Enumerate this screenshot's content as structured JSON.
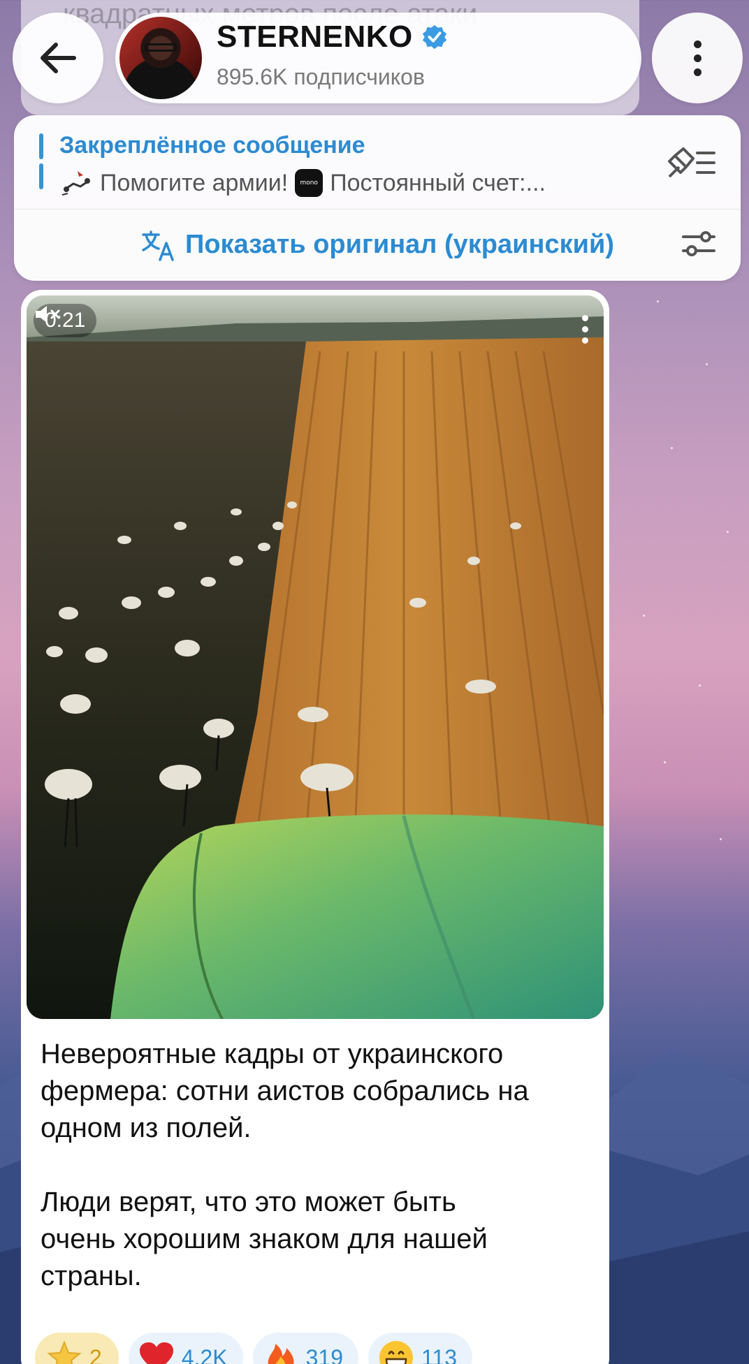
{
  "header": {
    "channel_name": "STERNENKO",
    "subscribers": "895.6K подписчиков"
  },
  "previous_message": {
    "text_fragment": "квадратных метров после атаки"
  },
  "pinned": {
    "title": "Закреплённое сообщение",
    "text_part1": "Помогите армии!",
    "text_part2": "Постоянный счет:...",
    "mono_label": "mono"
  },
  "translate": {
    "label": "Показать оригинал (украинский)"
  },
  "video": {
    "duration": "0:21",
    "muted": true
  },
  "message": {
    "caption": "Невероятные кадры от украинского\nфермера: сотни аистов собрались на\nодном из полей.\n\nЛюди верят, что это может быть\nочень хорошим знаком для нашей\nстраны."
  },
  "reactions": [
    {
      "emoji": "star",
      "count": "2"
    },
    {
      "emoji": "heart",
      "count": "4.2K"
    },
    {
      "emoji": "fire",
      "count": "319"
    },
    {
      "emoji": "grin",
      "count": "113"
    }
  ],
  "colors": {
    "accent": "#2c8bd1",
    "star_bg": "#f8e9b5"
  }
}
